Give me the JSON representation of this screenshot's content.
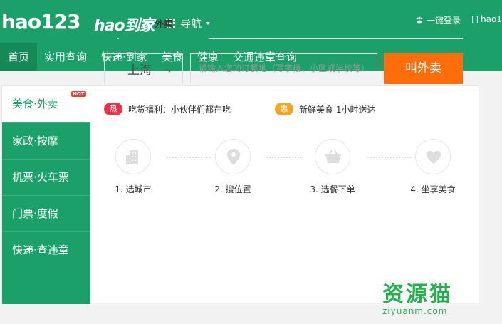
{
  "header": {
    "logo_main": "hao123",
    "logo_sub": "hao到家",
    "guide_label": "导航",
    "login_label": "一键登录",
    "phone_label": "hao1"
  },
  "menu": [
    {
      "label": "首页"
    },
    {
      "label": "实用查询"
    },
    {
      "label": "快递·到家"
    },
    {
      "label": "美食"
    },
    {
      "label": "健康"
    },
    {
      "label": "交通违章查询"
    }
  ],
  "sidebar": {
    "hot_badge": "HOT",
    "items": [
      {
        "label": "美食·外卖"
      },
      {
        "label": "家政·按摩"
      },
      {
        "label": "机票·火车票"
      },
      {
        "label": "门票·度假"
      },
      {
        "label": "快递·查违章"
      }
    ]
  },
  "tabs": [
    {
      "label": "外卖"
    }
  ],
  "form": {
    "city": "上海",
    "address_placeholder": "请输入您的订餐地（写字楼、小区或学校等）",
    "order_button": "叫外卖"
  },
  "promos": [
    {
      "badge": "热",
      "text": "吃货福利：小伙伴们都在吃",
      "color": "#e8334a"
    },
    {
      "badge": "惠",
      "text": "新鲜美食 1小时送达",
      "color": "#f5a623"
    }
  ],
  "steps": [
    {
      "label": "1. 选城市",
      "icon": "buildings-icon"
    },
    {
      "label": "2. 搜位置",
      "icon": "location-pin-icon"
    },
    {
      "label": "3. 选餐下单",
      "icon": "basket-icon"
    },
    {
      "label": "4. 坐享美食",
      "icon": "heart-icon"
    }
  ],
  "watermark": {
    "title": "资源猫",
    "url": "ziyuanm.com"
  },
  "colors": {
    "brand": "#1aa068",
    "accent": "#ff6d0a",
    "hot": "#e84437"
  }
}
